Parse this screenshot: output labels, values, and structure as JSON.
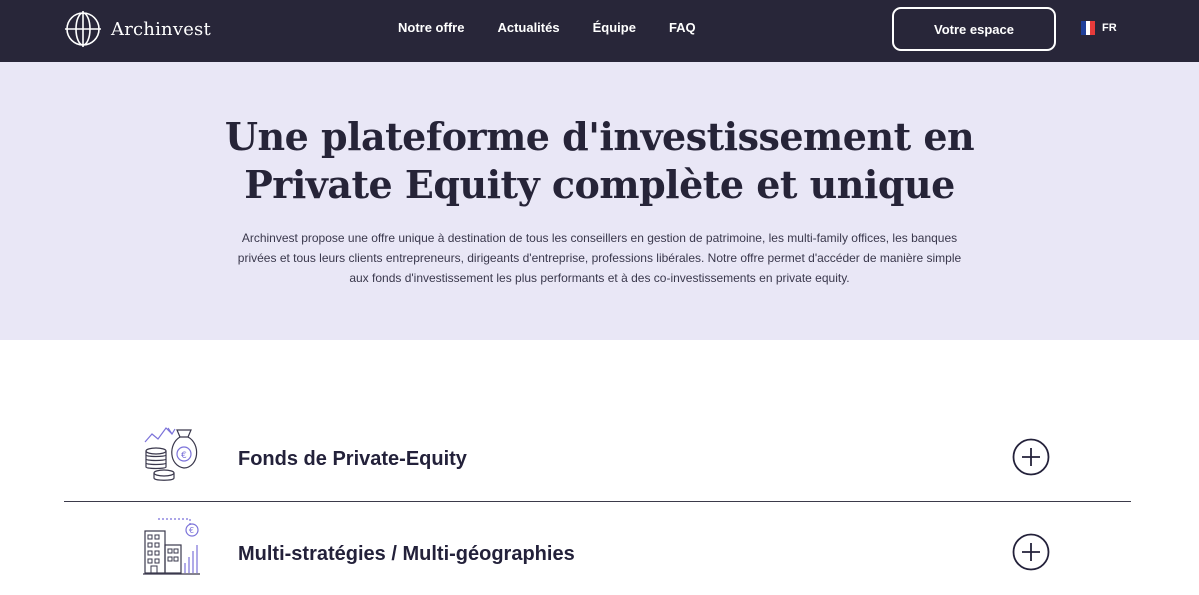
{
  "header": {
    "brand": "Archinvest",
    "brand_icon": "globe-icon",
    "nav": [
      "Notre offre",
      "Actualités",
      "Équipe",
      "FAQ"
    ],
    "cta": "Votre espace",
    "language": "FR",
    "flag_colors": [
      "#1f3f9a",
      "#ffffff",
      "#e63b3b"
    ]
  },
  "hero": {
    "title_line1": "Une plateforme d'investissement en",
    "title_line2": "Private Equity complète et unique",
    "text_line1": "Archinvest propose une offre unique à destination de tous les conseillers en gestion de patrimoine, les multi-family offices, les banques",
    "text_line2": "privées et tous leurs clients entrepreneurs, dirigeants d'entreprise, professions libérales. Notre offre permet d'accéder de manière simple",
    "text_line3": "aux fonds d'investissement les plus performants et à des co-investissements en private equity."
  },
  "offers": [
    {
      "label": "Fonds de Private-Equity",
      "icon": "coins-money-bag-icon",
      "toggle_icon": "plus-circle-icon"
    },
    {
      "label": "Multi-stratégies / Multi-géographies",
      "icon": "buildings-chart-icon",
      "toggle_icon": "plus-circle-icon"
    }
  ],
  "colors": {
    "header_bg": "#282639",
    "hero_bg": "#e9e7f6",
    "accent": "#7b72d9",
    "text": "#23213a"
  }
}
